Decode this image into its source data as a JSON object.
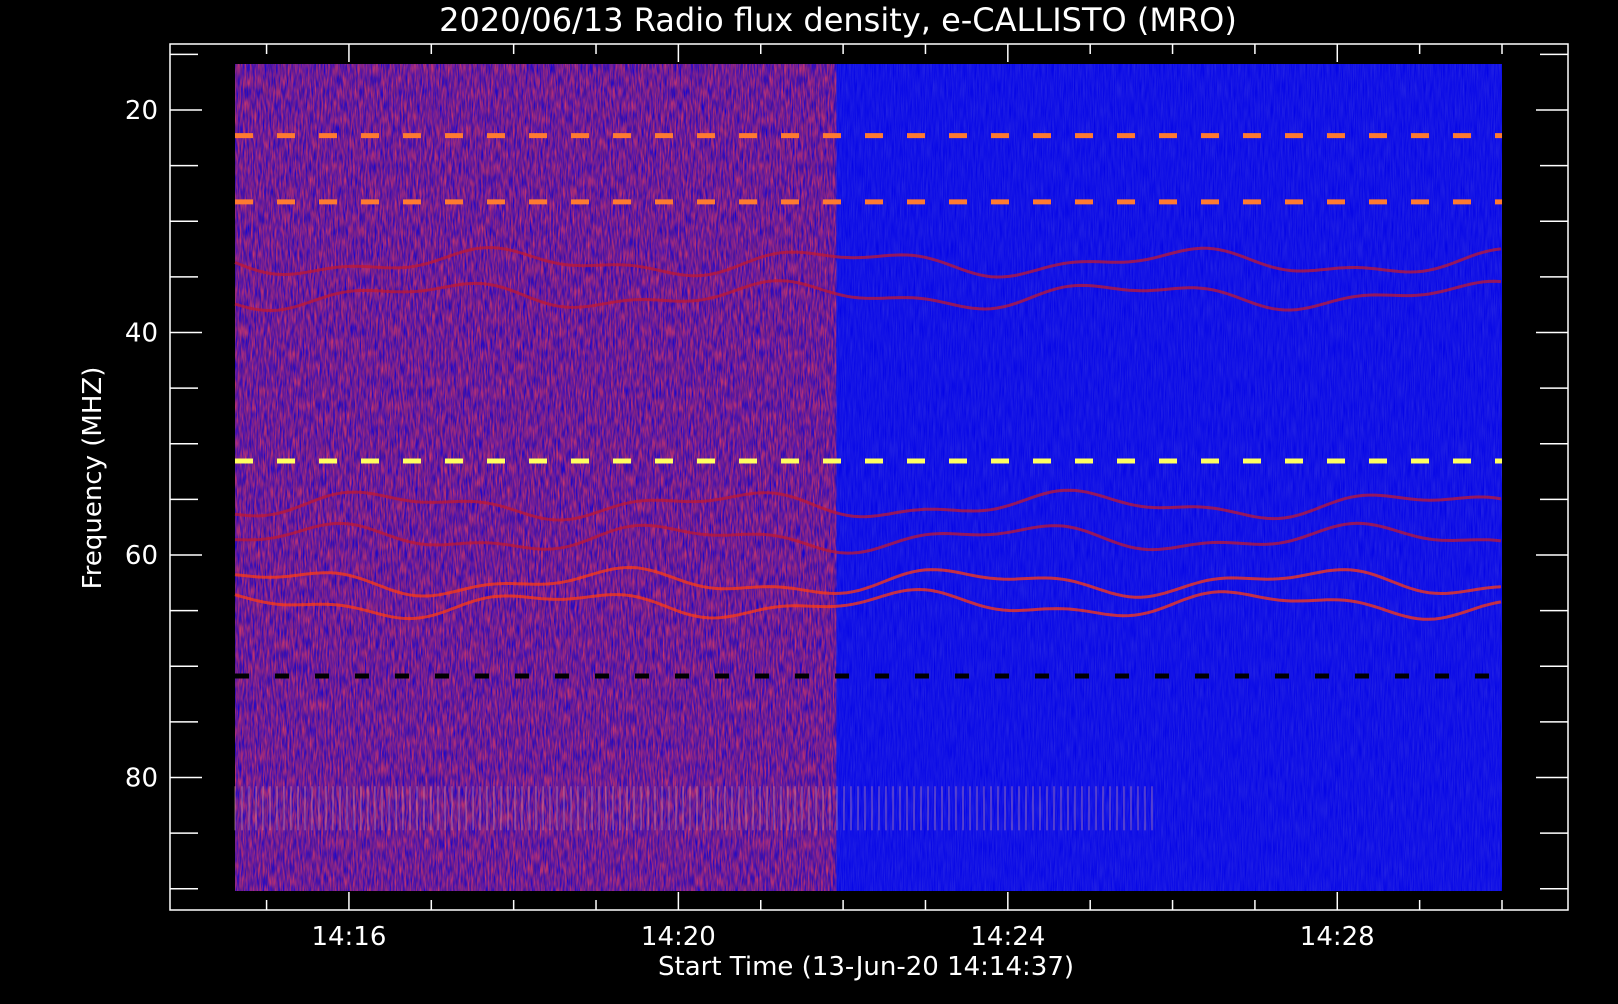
{
  "chart_data": {
    "type": "heatmap",
    "title": "2020/06/13  Radio flux density, e-CALLISTO (MRO)",
    "xlabel": "Start Time (13-Jun-20 14:14:37)",
    "ylabel": "Frequency (MHZ)",
    "x_range": [
      "14:14:37",
      "14:30:00"
    ],
    "x_ticks": [
      "14:16",
      "14:20",
      "14:24",
      "14:28"
    ],
    "y_range": [
      15,
      90
    ],
    "y_ticks": [
      "20",
      "40",
      "60",
      "80"
    ],
    "y_axis_reversed": true,
    "colormap": [
      "#000000",
      "#1a1adc",
      "#3434ff",
      "#a01020",
      "#ff3000",
      "#ffff60"
    ],
    "features": [
      {
        "name": "narrowband interference",
        "frequency_mhz": 21.5,
        "time_start": "14:14:37",
        "time_end": "14:30:00",
        "color": "#ff7a30"
      },
      {
        "name": "narrowband interference",
        "frequency_mhz": 27.5,
        "time_start": "14:14:37",
        "time_end": "14:30:00",
        "color": "#ff7a30"
      },
      {
        "name": "narrowband interference",
        "frequency_mhz": 51.0,
        "time_start": "14:14:37",
        "time_end": "14:30:00",
        "color": "#ffff60"
      },
      {
        "name": "dark band",
        "frequency_mhz": 70.5,
        "time_start": "14:14:37",
        "time_end": "14:30:00",
        "color": "#000000"
      },
      {
        "name": "elevated background",
        "frequency_start_mhz": 15,
        "frequency_end_mhz": 90,
        "time_start": "14:14:37",
        "time_end": "14:21:55",
        "color": "#a01020"
      },
      {
        "name": "lower background",
        "frequency_start_mhz": 15,
        "frequency_end_mhz": 90,
        "time_start": "14:21:55",
        "time_end": "14:30:00",
        "color": "#1a1adc"
      }
    ]
  }
}
